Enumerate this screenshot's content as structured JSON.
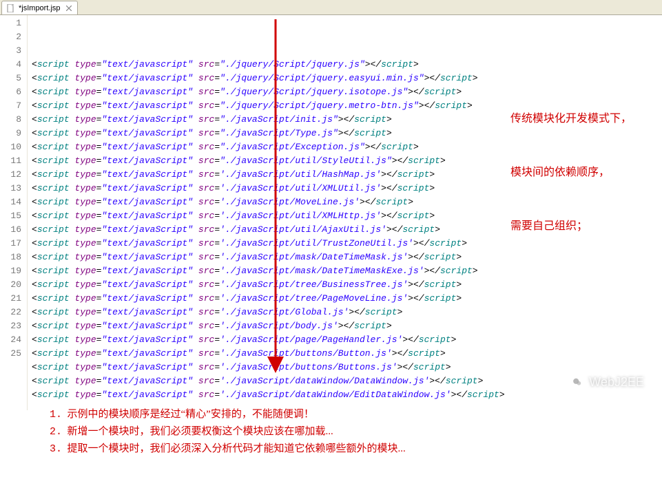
{
  "tab": {
    "title": "*jsImport.jsp",
    "icon_label": "jsp-file-icon",
    "close_label": "close"
  },
  "code_lines": [
    {
      "n": 1,
      "type": "text/javascript",
      "src": "./jquery/Script/jquery.js"
    },
    {
      "n": 2,
      "type": "text/javascript",
      "src": "./jquery/Script/jquery.easyui.min.js"
    },
    {
      "n": 3,
      "type": "text/javascript",
      "src": "./jquery/Script/jquery.isotope.js"
    },
    {
      "n": 4,
      "type": "text/javascript",
      "src": "./jquery/Script/jquery.metro-btn.js"
    },
    {
      "n": 5,
      "type": "text/javaScript",
      "src": "./javaScript/init.js"
    },
    {
      "n": 6,
      "type": "text/javaScript",
      "src": "./javaScript/Type.js"
    },
    {
      "n": 7,
      "type": "text/javaScript",
      "src": "./javaScript/Exception.js"
    },
    {
      "n": 8,
      "type": "text/javaScript",
      "src": "./javaScript/util/StyleUtil.js"
    },
    {
      "n": 9,
      "type": "text/javaScript",
      "src": "./javaScript/util/HashMap.js",
      "quote": "'"
    },
    {
      "n": 10,
      "type": "text/javaScript",
      "src": "./javaScript/util/XMLUtil.js",
      "quote": "'"
    },
    {
      "n": 11,
      "type": "text/javaScript",
      "src": "./javaScript/MoveLine.js",
      "quote": "'"
    },
    {
      "n": 12,
      "type": "text/javaScript",
      "src": "./javaScript/util/XMLHttp.js",
      "quote": "'"
    },
    {
      "n": 13,
      "type": "text/javaScript",
      "src": "./javaScript/util/AjaxUtil.js",
      "quote": "'"
    },
    {
      "n": 14,
      "type": "text/javaScript",
      "src": "./javaScript/util/TrustZoneUtil.js",
      "quote": "'"
    },
    {
      "n": 15,
      "type": "text/javaScript",
      "src": "./javaScript/mask/DateTimeMask.js",
      "quote": "'"
    },
    {
      "n": 16,
      "type": "text/javaScript",
      "src": "./javaScript/mask/DateTimeMaskExe.js",
      "quote": "'"
    },
    {
      "n": 17,
      "type": "text/javaScript",
      "src": "./javaScript/tree/BusinessTree.js",
      "quote": "'"
    },
    {
      "n": 18,
      "type": "text/javaScript",
      "src": "./javaScript/tree/PageMoveLine.js",
      "quote": "'"
    },
    {
      "n": 19,
      "type": "text/javaScript",
      "src": "./javaScript/Global.js",
      "quote": "'"
    },
    {
      "n": 20,
      "type": "text/javaScript",
      "src": "./javaScript/body.js",
      "quote": "'"
    },
    {
      "n": 21,
      "type": "text/javaScript",
      "src": "./javaScript/page/PageHandler.js",
      "quote": "'"
    },
    {
      "n": 22,
      "type": "text/javaScript",
      "src": "./javaScript/buttons/Button.js",
      "quote": "'"
    },
    {
      "n": 23,
      "type": "text/javaScript",
      "src": "./javaScript/buttons/Buttons.js",
      "quote": "'"
    },
    {
      "n": 24,
      "type": "text/javaScript",
      "src": "./javaScript/dataWindow/DataWindow.js",
      "quote": "'"
    },
    {
      "n": 25,
      "type": "text/javaScript",
      "src": "./javaScript/dataWindow/EditDataWindow.js",
      "quote": "'"
    }
  ],
  "side_annotation": {
    "line1": "传统模块化开发模式下，",
    "line2": "模块间的依赖顺序，",
    "line3": "需要自己组织；"
  },
  "bottom_notes": {
    "n1": "1.",
    "t1": "示例中的模块顺序是经过“精心”安排的，不能随便调！",
    "n2": "2.",
    "t2": "新增一个模块时，我们必须要权衡这个模块应该在哪加载...",
    "n3": "3.",
    "t3": "提取一个模块时，我们必须深入分析代码才能知道它依赖哪些额外的模块..."
  },
  "watermark": {
    "text": "WebJ2EE"
  },
  "colors": {
    "annotation": "#d00000"
  }
}
